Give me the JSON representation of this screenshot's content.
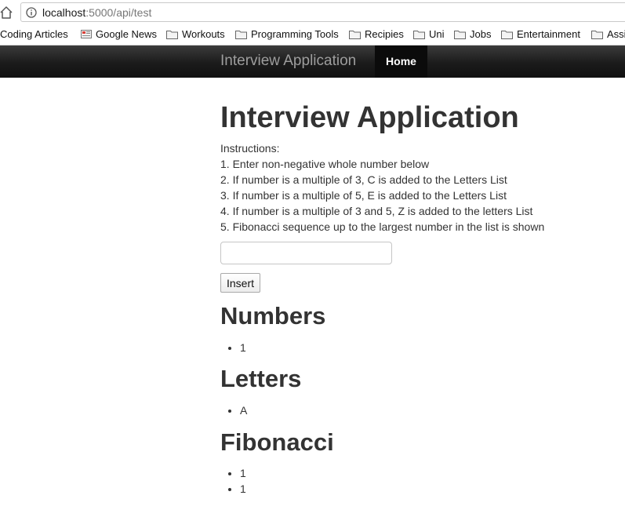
{
  "browser": {
    "url_host": "localhost",
    "url_rest": ":5000/api/test",
    "bookmarks": [
      {
        "label": "Coding Articles",
        "icon": "none"
      },
      {
        "label": "Google News",
        "icon": "news-icon"
      },
      {
        "label": "Workouts",
        "icon": "folder-icon"
      },
      {
        "label": "Programming Tools",
        "icon": "folder-icon"
      },
      {
        "label": "Recipies",
        "icon": "folder-icon"
      },
      {
        "label": "Uni",
        "icon": "folder-icon"
      },
      {
        "label": "Jobs",
        "icon": "folder-icon"
      },
      {
        "label": "Entertainment",
        "icon": "folder-icon"
      },
      {
        "label": "Assi",
        "icon": "folder-icon"
      }
    ]
  },
  "navbar": {
    "brand": "Interview Application",
    "home": "Home"
  },
  "page": {
    "title": "Interview Application",
    "instructions": [
      "Instructions:",
      "1. Enter non-negative whole number below",
      "2. If number is a multiple of 3, C is added to the Letters List",
      "3. If number is a multiple of 5, E is added to the Letters List",
      "4. If number is a multiple of 3 and 5, Z is added to the letters List",
      "5. Fibonacci sequence up to the largest number in the list is shown"
    ],
    "input_value": "",
    "insert_label": "Insert",
    "numbers": {
      "title": "Numbers",
      "items": [
        "1"
      ]
    },
    "letters": {
      "title": "Letters",
      "items": [
        "A"
      ]
    },
    "fibonacci": {
      "title": "Fibonacci",
      "items": [
        "1",
        "1"
      ]
    }
  },
  "colors": {
    "navbar_bg": "#1b1b1b",
    "brand_text": "#9d9d9d",
    "text": "#333333"
  }
}
